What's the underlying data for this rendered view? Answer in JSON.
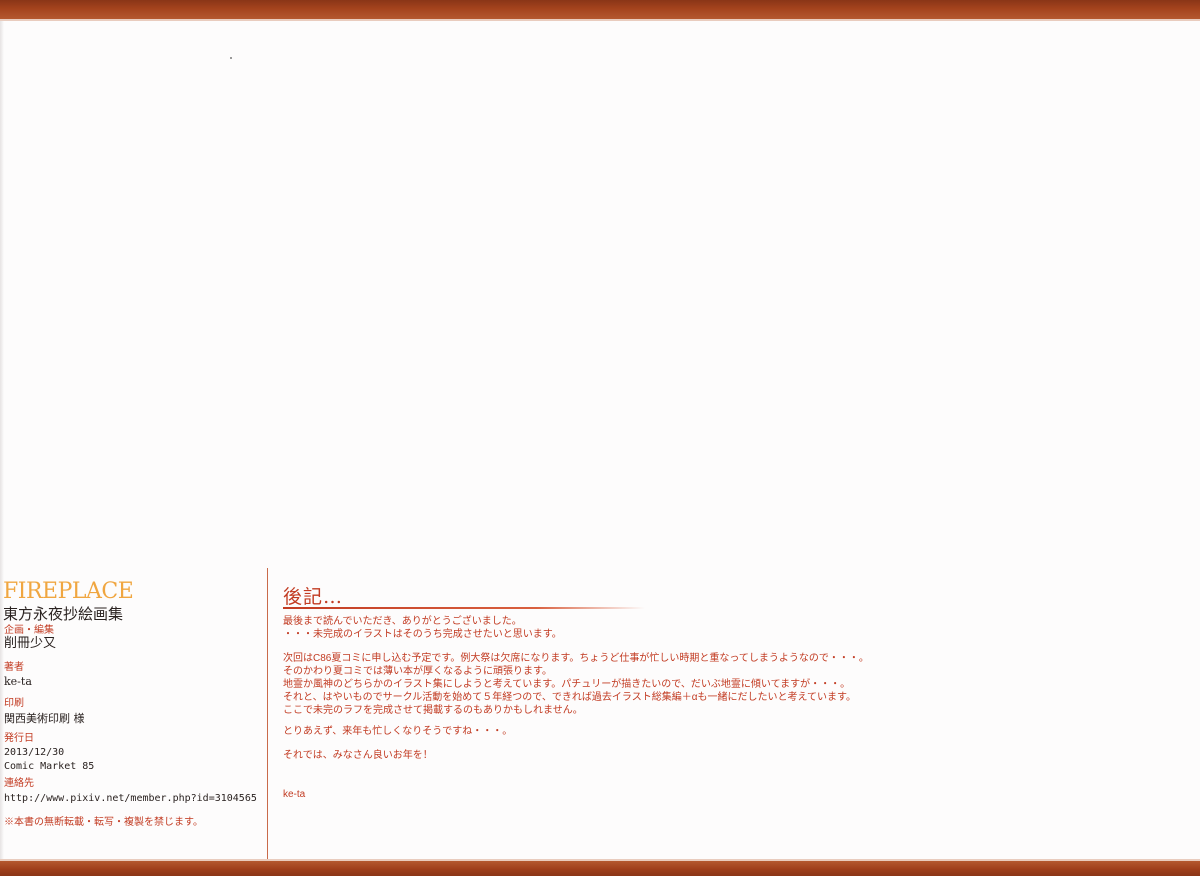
{
  "colophon": {
    "title": "FIREPLACE",
    "subtitle": "東方永夜抄絵画集",
    "planning_label": "企画・編集",
    "planning_value": "削冊少又",
    "author_label": "著者",
    "author_value": "ke-ta",
    "print_label": "印刷",
    "print_value": "関西美術印刷 様",
    "issue_label": "発行日",
    "issue_date": "2013/12/30",
    "issue_event": "Comic Market 85",
    "contact_label": "連絡先",
    "contact_url": "http://www.pixiv.net/member.php?id=3104565",
    "notice": "※本書の無断転載・転写・複製を禁じます。"
  },
  "afterword": {
    "title": "後記…",
    "lines": [
      "最後まで読んでいただき、ありがとうございました。",
      "・・・未完成のイラストはそのうち完成させたいと思います。",
      "",
      "次回はC86夏コミに申し込む予定です。例大祭は欠席になります。ちょうど仕事が忙しい時期と重なってしまうようなので・・・。",
      "そのかわり夏コミでは薄い本が厚くなるように頑張ります。",
      "地霊か風神のどちらかのイラスト集にしようと考えています。パチュリーが描きたいので、だいぶ地霊に傾いてますが・・・。",
      "それと、はやいものでサークル活動を始めて５年経つので、できれば過去イラスト総集編＋αも一緒にだしたいと考えています。",
      "ここで未完のラフを完成させて掲載するのもありかもしれません。",
      "",
      "とりあえず、来年も忙しくなりそうですね・・・。",
      "",
      "それでは、みなさん良いお年を！",
      "",
      "",
      "ke-ta"
    ]
  },
  "colors": {
    "band": "#a4431d",
    "accent_red": "#c23b22",
    "title_orange": "#f0a640",
    "text_dark": "#2a2220"
  }
}
